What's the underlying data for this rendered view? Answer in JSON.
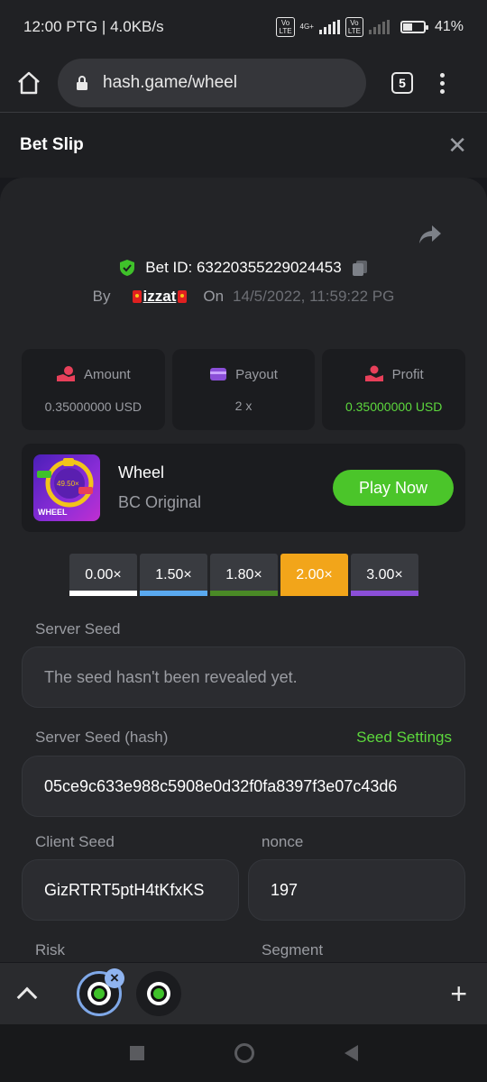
{
  "status": {
    "time_speed": "12:00 PTG | 4.0KB/s",
    "battery": "41%",
    "network": "4G+",
    "volte": "Vo LTE"
  },
  "browser": {
    "url": "hash.game/wheel",
    "tab_count": "5"
  },
  "sheet": {
    "title": "Bet Slip",
    "close": "✕"
  },
  "bet": {
    "id_label": "Bet ID: 63220355229024453",
    "by_label": "By",
    "username": "izzat",
    "on_label": "On",
    "datetime": "14/5/2022, 11:59:22 PG"
  },
  "stats": [
    {
      "label": "Amount",
      "value": "0.35000000 USD",
      "icon": "coins-icon"
    },
    {
      "label": "Payout",
      "value": "2 x",
      "icon": "wallet-icon"
    },
    {
      "label": "Profit",
      "value": "0.35000000 USD",
      "icon": "hand-coin-icon"
    }
  ],
  "game": {
    "name": "Wheel",
    "provider": "BC Original",
    "play_label": "Play Now",
    "thumb_label": "WHEEL",
    "thumb_center": "49.50×"
  },
  "multipliers": [
    {
      "label": "0.00×",
      "color": "#ffffff"
    },
    {
      "label": "1.50×",
      "color": "#5aa9ef"
    },
    {
      "label": "1.80×",
      "color": "#4a8a26"
    },
    {
      "label": "2.00×",
      "color": "#f2a51a"
    },
    {
      "label": "3.00×",
      "color": "#8b4fd8"
    }
  ],
  "fields": {
    "server_seed_label": "Server Seed",
    "server_seed_value": "The seed hasn't been revealed yet.",
    "server_hash_label": "Server Seed (hash)",
    "seed_settings": "Seed Settings",
    "server_hash_value": "05ce9c633e988c5908e0d32f0fa8397f3e07c43d6",
    "client_seed_label": "Client Seed",
    "client_seed_value": "GizRTRT5ptH4tKfxKS",
    "nonce_label": "nonce",
    "nonce_value": "197",
    "risk_label": "Risk",
    "segment_label": "Segment"
  },
  "tabbar": {
    "plus": "+"
  },
  "colors": {
    "accent_green": "#4bc52a",
    "active_mult": "#f2a51a"
  }
}
